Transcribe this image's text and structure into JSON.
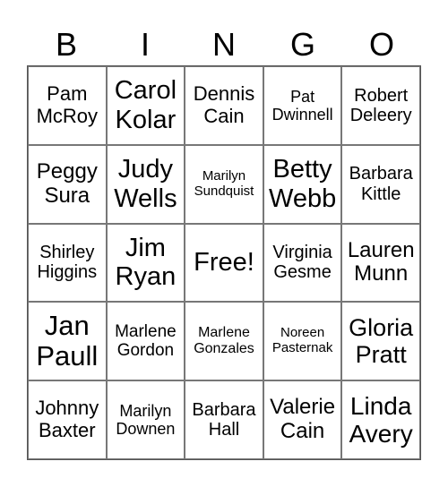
{
  "header": [
    "B",
    "I",
    "N",
    "G",
    "O"
  ],
  "cells": [
    [
      "Pam McRoy",
      "Carol Kolar",
      "Dennis Cain",
      "Pat Dwinnell",
      "Robert Deleery"
    ],
    [
      "Peggy Sura",
      "Judy Wells",
      "Marilyn Sundquist",
      "Betty Webb",
      "Barbara Kittle"
    ],
    [
      "Shirley Higgins",
      "Jim Ryan",
      "Free!",
      "Virginia Gesme",
      "Lauren Munn"
    ],
    [
      "Jan Paull",
      "Marlene Gordon",
      "Marlene Gonzales",
      "Noreen Pasternak",
      "Gloria Pratt"
    ],
    [
      "Johnny Baxter",
      "Marilyn Downen",
      "Barbara Hall",
      "Valerie Cain",
      "Linda Avery"
    ]
  ]
}
